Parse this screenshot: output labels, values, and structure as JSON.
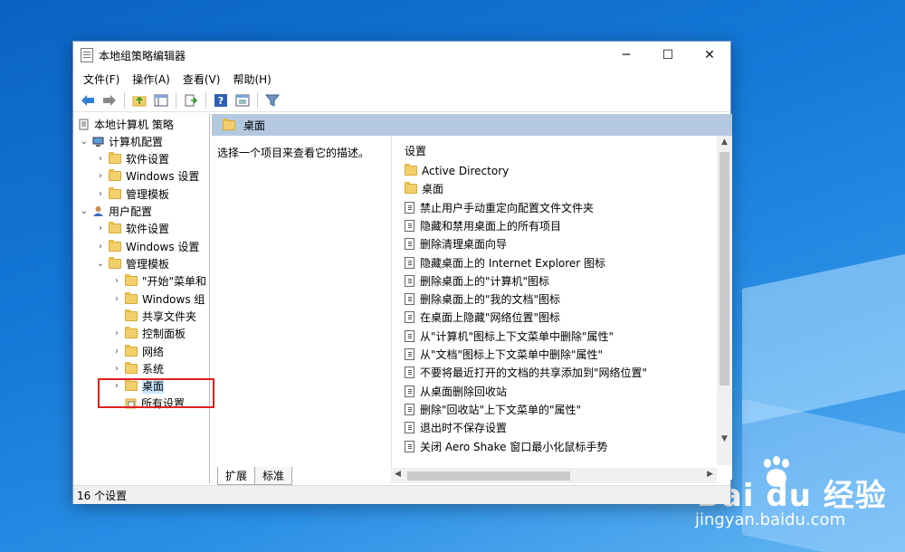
{
  "window": {
    "title": "本地组策略编辑器",
    "controls": {
      "minimize": "─",
      "maximize": "☐",
      "close": "✕"
    }
  },
  "menu": [
    "文件(F)",
    "操作(A)",
    "查看(V)",
    "帮助(H)"
  ],
  "toolbar": {
    "icons": [
      "back-arrow-icon",
      "forward-arrow-icon",
      "up-folder-icon",
      "show-hide-tree-icon",
      "export-list-icon",
      "help-icon",
      "properties-icon",
      "filter-icon"
    ]
  },
  "tree": {
    "root": "本地计算机 策略",
    "computer_config": "计算机配置",
    "computer_software": "软件设置",
    "computer_windows": "Windows 设置",
    "computer_admin": "管理模板",
    "user_config": "用户配置",
    "user_software": "软件设置",
    "user_windows": "Windows 设置",
    "user_admin": "管理模板",
    "start_menu": "\"开始\"菜单和",
    "windows_components": "Windows 组",
    "shared_folders": "共享文件夹",
    "control_panel": "控制面板",
    "network": "网络",
    "system": "系统",
    "desktop": "桌面",
    "all_settings": "所有设置"
  },
  "right": {
    "header": "桌面",
    "description": "选择一个项目来查看它的描述。",
    "column_header": "设置",
    "items": [
      {
        "label": "Active Directory",
        "type": "folder"
      },
      {
        "label": "桌面",
        "type": "folder"
      },
      {
        "label": "禁止用户手动重定向配置文件文件夹",
        "type": "setting"
      },
      {
        "label": "隐藏和禁用桌面上的所有项目",
        "type": "setting"
      },
      {
        "label": "删除清理桌面向导",
        "type": "setting"
      },
      {
        "label": "隐藏桌面上的 Internet Explorer 图标",
        "type": "setting"
      },
      {
        "label": "删除桌面上的\"计算机\"图标",
        "type": "setting"
      },
      {
        "label": "删除桌面上的\"我的文档\"图标",
        "type": "setting"
      },
      {
        "label": "在桌面上隐藏\"网络位置\"图标",
        "type": "setting"
      },
      {
        "label": "从\"计算机\"图标上下文菜单中删除\"属性\"",
        "type": "setting"
      },
      {
        "label": "从\"文档\"图标上下文菜单中删除\"属性\"",
        "type": "setting"
      },
      {
        "label": "不要将最近打开的文档的共享添加到\"网络位置\"",
        "type": "setting"
      },
      {
        "label": "从桌面删除回收站",
        "type": "setting"
      },
      {
        "label": "删除\"回收站\"上下文菜单的\"属性\"",
        "type": "setting"
      },
      {
        "label": "退出时不保存设置",
        "type": "setting"
      },
      {
        "label": "关闭 Aero Shake 窗口最小化鼠标手势",
        "type": "setting"
      }
    ]
  },
  "tabs": {
    "extended": "扩展",
    "standard": "标准"
  },
  "status": "16 个设置",
  "watermark": {
    "brand": "Bai du 经验",
    "url": "jingyan.baidu.com"
  }
}
